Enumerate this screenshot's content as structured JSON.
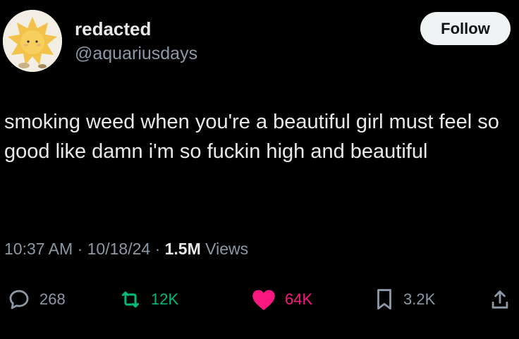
{
  "user": {
    "display_name": "redacted",
    "handle": "@aquariusdays",
    "avatar_icon": "sun-plush-avatar"
  },
  "follow_button": {
    "label": "Follow"
  },
  "tweet": {
    "text": "smoking weed when you're a beautiful girl must feel so good like damn i'm so fuckin high and beautiful",
    "time": "10:37 AM",
    "date": "10/18/24",
    "views_count": "1.5M",
    "views_label": "Views",
    "separator": "·"
  },
  "actions": {
    "replies": "268",
    "reposts": "12K",
    "likes": "64K",
    "bookmarks": "3.2K"
  },
  "colors": {
    "background": "#000000",
    "text": "#e7e9ea",
    "secondary": "#8b98a5",
    "repost_green": "#00ba7c",
    "like_pink": "#f91880",
    "follow_bg": "#eff3f4"
  }
}
